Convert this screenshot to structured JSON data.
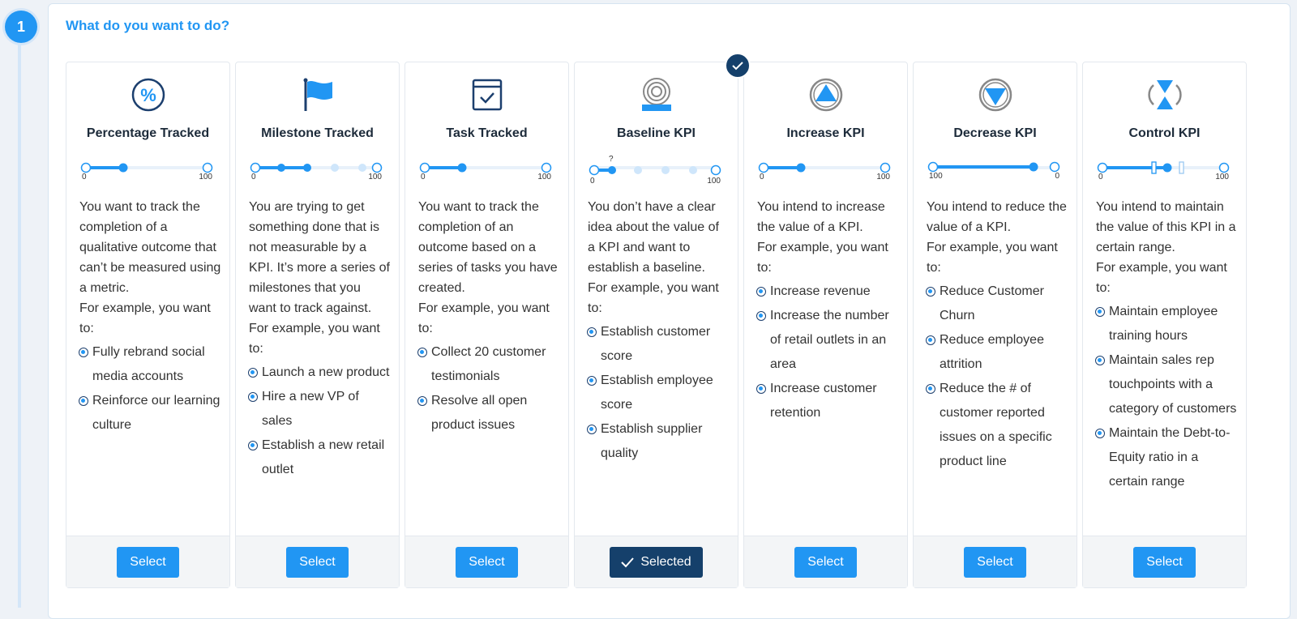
{
  "step": {
    "number": "1"
  },
  "question": "What do you want to do?",
  "colors": {
    "accent": "#2196f3",
    "selected": "#15406b"
  },
  "cards": [
    {
      "title": "Percentage Tracked",
      "icon": "percent-icon",
      "scale_start": "0",
      "scale_end": "100",
      "body": "You want to track the completion of a qualitative outcome that can’t be measured using a metric.",
      "example": "For example, you want to:",
      "items": [
        "Fully rebrand social media accounts",
        "Reinforce our learning culture"
      ],
      "button": "Select"
    },
    {
      "title": "Milestone Tracked",
      "icon": "flag-icon",
      "scale_start": "0",
      "scale_end": "100",
      "body": "You are trying to get something done that is not measurable by a KPI. It’s more a series of milestones that you want to track against.",
      "example": "For example, you want to:",
      "items": [
        "Launch a new product",
        "Hire a new VP of sales",
        "Establish a new retail outlet"
      ],
      "button": "Select"
    },
    {
      "title": "Task Tracked",
      "icon": "task-checklist-icon",
      "scale_start": "0",
      "scale_end": "100",
      "body": "You want to track the completion of an outcome based on a series of tasks you have created.",
      "example": "For example, you want to:",
      "items": [
        "Collect 20 customer testimonials",
        "Resolve all open product issues"
      ],
      "button": "Select"
    },
    {
      "title": "Baseline KPI",
      "icon": "baseline-target-icon",
      "scale_start": "0",
      "scale_end": "100",
      "scale_marker": "?",
      "body": "You don’t have a clear idea about the value of a KPI and want to establish a baseline.",
      "example": "For example, you want to:",
      "items": [
        "Establish customer score",
        "Establish employee score",
        "Establish supplier quality"
      ],
      "button": "Selected",
      "selected": true
    },
    {
      "title": "Increase KPI",
      "icon": "increase-arrow-icon",
      "scale_start": "0",
      "scale_end": "100",
      "body": "You intend to increase the value of a KPI.",
      "example": "For example, you want to:",
      "items": [
        "Increase revenue",
        "Increase the number of retail outlets in an area",
        "Increase customer retention"
      ],
      "button": "Select"
    },
    {
      "title": "Decrease KPI",
      "icon": "decrease-arrow-icon",
      "scale_start": "100",
      "scale_end": "0",
      "body": "You intend to reduce the value of a KPI.",
      "example": "For example, you want to:",
      "items": [
        "Reduce Customer Churn",
        "Reduce employee attrition",
        "Reduce the # of customer reported issues on a specific product line"
      ],
      "button": "Select"
    },
    {
      "title": "Control KPI",
      "icon": "control-range-icon",
      "scale_start": "0",
      "scale_end": "100",
      "body": "You intend to maintain the value of this KPI in a certain range.",
      "example": "For example, you want to:",
      "items": [
        "Maintain employee training hours",
        "Maintain sales rep touchpoints with a category of customers",
        "Maintain the Debt-to-Equity ratio in a certain range"
      ],
      "button": "Select"
    }
  ]
}
